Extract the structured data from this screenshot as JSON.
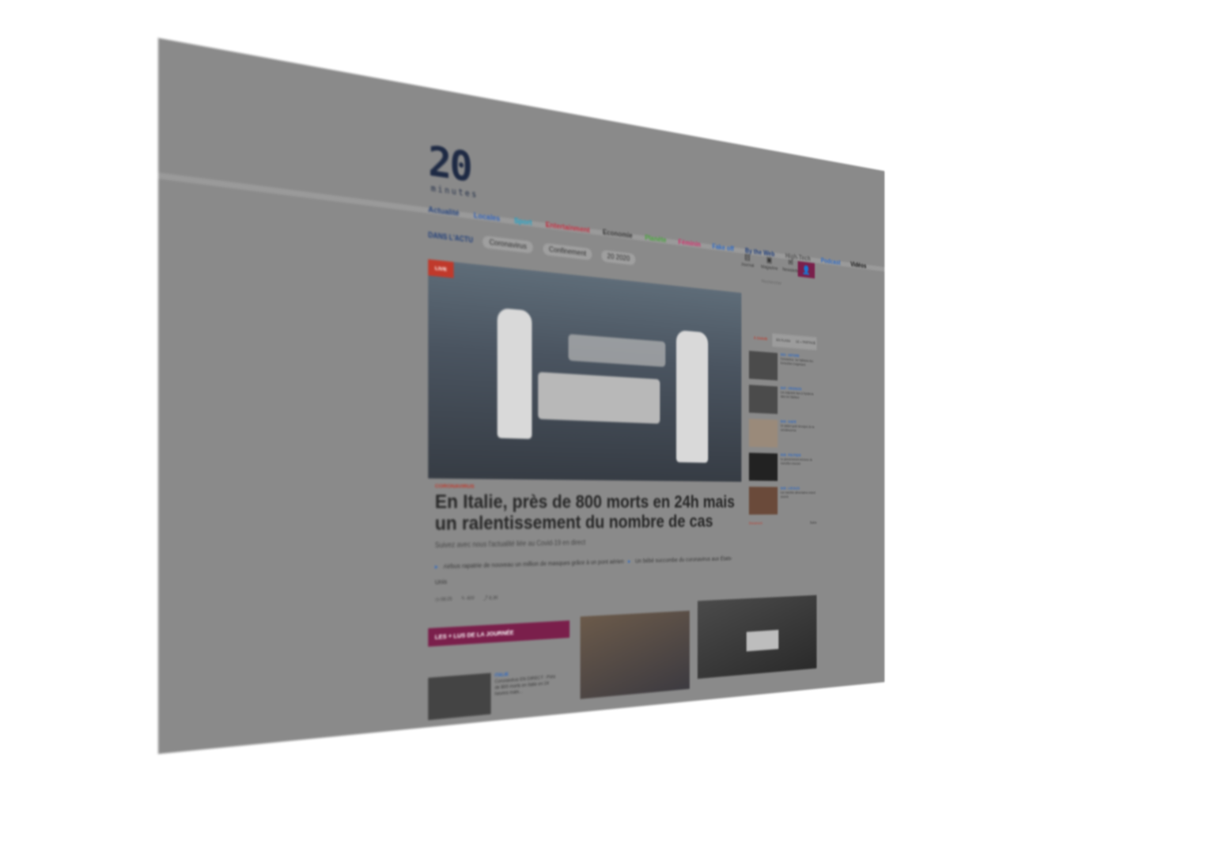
{
  "header": {
    "logo_text": "20",
    "logo_sub": "minutes",
    "nav": [
      "Actualité",
      "Locales",
      "Sport",
      "Entertainment",
      "Economie",
      "Planète",
      "Féminin",
      "Fake off",
      "By the Web",
      "High-Tech",
      "Podcast",
      "Vidéos"
    ],
    "icons": [
      {
        "icon": "newspaper-icon",
        "label": "Journal"
      },
      {
        "icon": "video-icon",
        "label": "Magazine"
      },
      {
        "icon": "newsletter-icon",
        "label": "Newsletter"
      }
    ],
    "search_placeholder": "Rechercher"
  },
  "dans_lactu": {
    "label": "DANS L'ACTU",
    "tags": [
      "Coronavirus",
      "Confinement",
      "20 2020"
    ]
  },
  "hero": {
    "badge": "LIVE",
    "kicker": "CORONAVIRUS",
    "headline": "En Italie, près de 800 morts en 24h mais un ralentissement du nombre de cas",
    "subtitle": "Suivez avec nous l'actualité liée au Covid-19 en direct",
    "related": [
      "Airbus rapatrie de nouveau un million de masques grâce à un pont aérien",
      "Un bébé succombe du coronavirus aux États-Unis"
    ],
    "stats": {
      "time": "08:25",
      "comments": "409",
      "shares": "8,3K"
    }
  },
  "sidebar": {
    "tabs": [
      "À CHAUD",
      "EN FLASH",
      "LE + PARTAGÉ"
    ],
    "items": [
      {
        "time": "9h51 · HISTOIRE",
        "text": "Coronavirus : les habitants des immeubles s'organisent"
      },
      {
        "time": "9h47 · URGENCES",
        "text": "Les soignants face à l'épidémie dans les hôpitaux"
      },
      {
        "time": "9h42 · SANTÉ",
        "text": "Un patient guéri témoigne de sa convalescence"
      },
      {
        "time": "9h38 · POLITIQUE",
        "text": "Le gouvernement annonce de nouvelles mesures"
      },
      {
        "time": "9h30 · LOCALES",
        "text": "Les marchés alimentaires restent ouverts"
      }
    ],
    "footer_left": "Directement",
    "footer_right": "Suivre"
  },
  "tops": {
    "title": "LES + LUS DE LA JOURNÉE",
    "item": {
      "category": "ITALIE",
      "text": "Coronavirus EN DIRECT : Près de 800 morts en Italie en 24 heures mais..."
    }
  }
}
